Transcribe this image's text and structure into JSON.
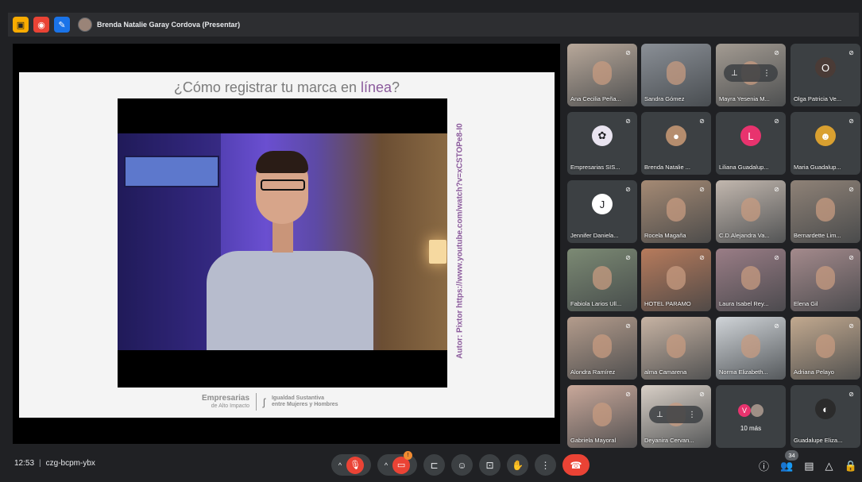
{
  "topbar": {
    "presenter_label": "Brenda Natalie Garay Cordova (Presentar)"
  },
  "slide": {
    "title_prefix": "¿Cómo registrar tu marca en ",
    "title_highlight": "línea",
    "title_suffix": "?",
    "vertical_credit": "Autor: Pixtor https://www.youtube.com/watch?v=xCSTOPe8-I0",
    "logo1_line1": "Empresarias",
    "logo1_line2": "de Alto Impacto",
    "logo2_line1": "Igualdad Sustantiva",
    "logo2_line2": "entre Mujeres y Hombres"
  },
  "participants": [
    {
      "name": "Ana Cecilia Peña...",
      "type": "video",
      "color": "#b8a89a",
      "muted": true
    },
    {
      "name": "Sandra Gómez",
      "type": "video",
      "color": "#8a8f96",
      "muted": false
    },
    {
      "name": "Mayra Yesenia M...",
      "type": "video",
      "color": "#a39b92",
      "muted": true,
      "pin": true
    },
    {
      "name": "Olga Patricia Ve...",
      "type": "avatar",
      "initial": "O",
      "avatar_color": "#4a3b36",
      "muted": true
    },
    {
      "name": "Empresarias SIS...",
      "type": "avatar",
      "initial": "✿",
      "avatar_color": "#e9e4f0",
      "muted": true
    },
    {
      "name": "Brenda Natalie ...",
      "type": "avatar",
      "initial": "●",
      "avatar_color": "#b58d6e",
      "muted": true
    },
    {
      "name": "Liliana Guadalup...",
      "type": "avatar",
      "initial": "L",
      "avatar_color": "#e8336e",
      "muted": true
    },
    {
      "name": "Maria Guadalup...",
      "type": "avatar",
      "initial": "☻",
      "avatar_color": "#d9a030",
      "muted": true
    },
    {
      "name": "Jennifer Daniela...",
      "type": "avatar",
      "initial": "J",
      "avatar_color": "#ffffff",
      "muted": true
    },
    {
      "name": "Rocela Magaña",
      "type": "video",
      "color": "#a58a74",
      "muted": true
    },
    {
      "name": "C.D.Alejandra Va...",
      "type": "video",
      "color": "#c2b7ae",
      "muted": true
    },
    {
      "name": "Bernardette Lim...",
      "type": "video",
      "color": "#8f8277",
      "muted": true
    },
    {
      "name": "Fabiola Larios Ull...",
      "type": "video",
      "color": "#7c8a74",
      "muted": true
    },
    {
      "name": "HOTEL PARAMO",
      "type": "video",
      "color": "#b77b5c",
      "muted": true
    },
    {
      "name": "Laura Isabel Rey...",
      "type": "video",
      "color": "#9a7d86",
      "muted": true
    },
    {
      "name": "Elena Gil",
      "type": "video",
      "color": "#a48a8c",
      "muted": true
    },
    {
      "name": "Alondra Ramírez",
      "type": "video",
      "color": "#b49c8c",
      "muted": true
    },
    {
      "name": "alma Camarena",
      "type": "video",
      "color": "#c7b3a3",
      "muted": false
    },
    {
      "name": "Norma Elizabeth...",
      "type": "video",
      "color": "#d0d4d8",
      "muted": true
    },
    {
      "name": "Adriana Pelayo",
      "type": "video",
      "color": "#c2a98f",
      "muted": true
    },
    {
      "name": "Gabriela Mayoral",
      "type": "video",
      "color": "#c9a89a",
      "muted": true
    },
    {
      "name": "Deyanira Cervan...",
      "type": "video",
      "color": "#d8cfc6",
      "muted": true,
      "pin": true
    },
    {
      "name": "",
      "type": "more",
      "more_label": "10 más",
      "initial": "V"
    },
    {
      "name": "Guadalupe Eliza...",
      "type": "avatar",
      "initial": "◐",
      "avatar_color": "#2b2b2b",
      "muted": true
    }
  ],
  "bottombar": {
    "time": "12:53",
    "meeting_code": "czg-bcpm-ybx",
    "participant_count": "34",
    "alert_badge": "!"
  }
}
